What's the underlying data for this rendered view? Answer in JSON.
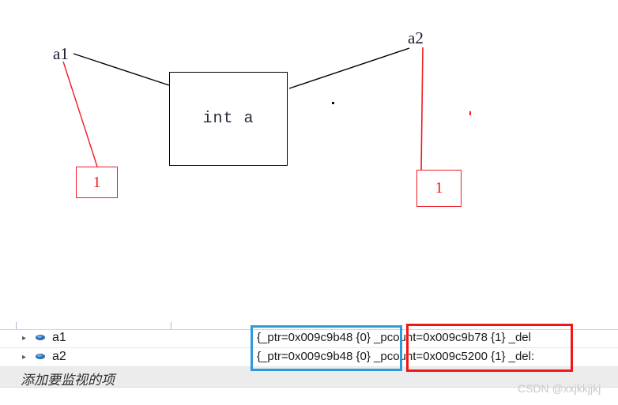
{
  "diagram": {
    "labels": {
      "left_pointer": "a1",
      "right_pointer": "a2"
    },
    "object_box": {
      "text": "int a"
    },
    "count_box_left": {
      "value": "1"
    },
    "count_box_right": {
      "value": "1"
    },
    "colors": {
      "box_border": "#000000",
      "red": "#ee1c25"
    }
  },
  "watch_panel": {
    "rows": [
      {
        "name": "a1",
        "expander": "▸",
        "icon": "field-oval-icon",
        "value": "{_ptr=0x009c9b48 {0} _pcount=0x009c9b78 {1} _del"
      },
      {
        "name": "a2",
        "expander": "▸",
        "icon": "field-oval-icon",
        "value": "{_ptr=0x009c9b48 {0} _pcount=0x009c5200 {1} _del:"
      }
    ],
    "add_watch_placeholder": "添加要监视的项",
    "highlights": {
      "blue_color": "#2e9bd6",
      "red_color": "#f21616"
    }
  },
  "watermark": {
    "text": "CSDN @xxjkkjjkj"
  }
}
